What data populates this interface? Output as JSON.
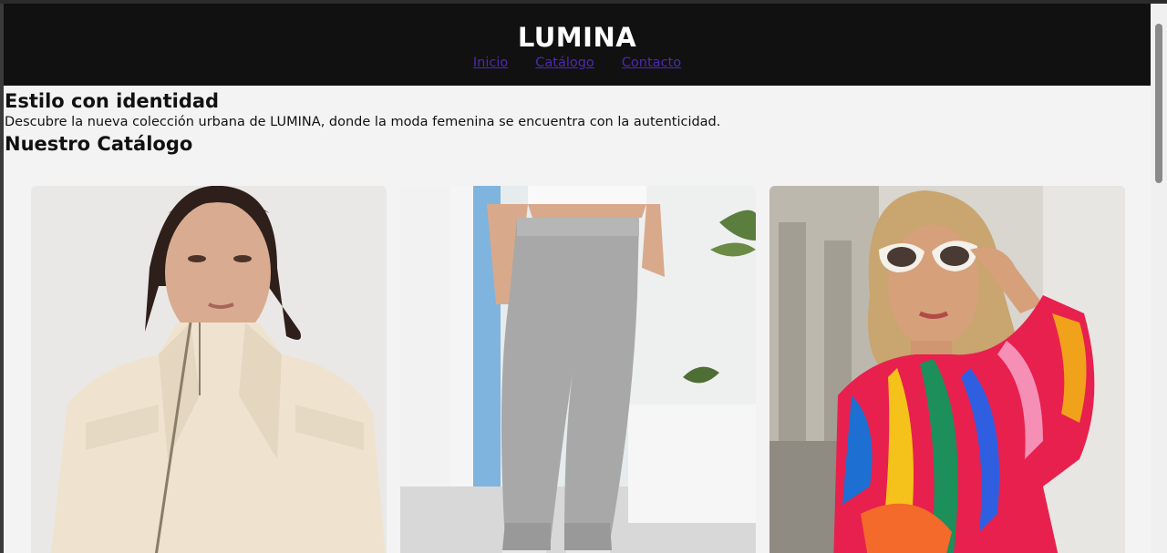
{
  "header": {
    "brand": "LUMINA",
    "nav": [
      {
        "label": "Inicio"
      },
      {
        "label": "Catálogo"
      },
      {
        "label": "Contacto"
      }
    ]
  },
  "hero": {
    "title": "Estilo con identidad",
    "text": "Descubre la nueva colección urbana de LUMINA, donde la moda femenina se encuentra con la autenticidad."
  },
  "catalog": {
    "title": "Nuestro Catálogo",
    "products": [
      {
        "name": "cream-jacket"
      },
      {
        "name": "gray-joggers"
      },
      {
        "name": "colorful-blouse"
      }
    ]
  },
  "colors": {
    "header_bg": "#111111",
    "page_bg": "#f3f3f3",
    "link": "#4b2ab0"
  }
}
